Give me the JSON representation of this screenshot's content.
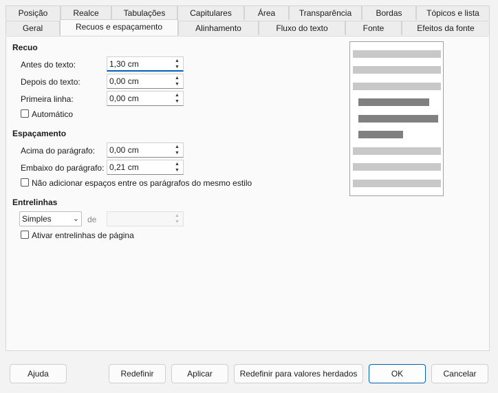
{
  "tabs_row1": [
    "Posição",
    "Realce",
    "Tabulações",
    "Capitulares",
    "Área",
    "Transparência",
    "Bordas",
    "Tópicos e lista"
  ],
  "tabs_row2": [
    "Geral",
    "Recuos e espaçamento",
    "Alinhamento",
    "Fluxo do texto",
    "Fonte",
    "Efeitos da fonte"
  ],
  "active_tab": "Recuos e espaçamento",
  "recuo": {
    "title": "Recuo",
    "antes_label": "Antes do texto:",
    "antes_value": "1,30 cm",
    "depois_label": "Depois do texto:",
    "depois_value": "0,00 cm",
    "primeira_label": "Primeira linha:",
    "primeira_value": "0,00 cm",
    "automatico_label": "Automático",
    "automatico_checked": false
  },
  "espacamento": {
    "title": "Espaçamento",
    "acima_label": "Acima do parágrafo:",
    "acima_value": "0,00 cm",
    "embaixo_label": "Embaixo do parágrafo:",
    "embaixo_value": "0,21 cm",
    "nao_adicionar_label": "Não adicionar espaços entre os parágrafos do mesmo estilo",
    "nao_adicionar_checked": false
  },
  "entrelinhas": {
    "title": "Entrelinhas",
    "selected": "Simples",
    "de_label": "de",
    "de_value": "",
    "ativar_label": "Ativar entrelinhas de página",
    "ativar_checked": false
  },
  "buttons": {
    "ajuda": "Ajuda",
    "redefinir": "Redefinir",
    "aplicar": "Aplicar",
    "herdados": "Redefinir para valores herdados",
    "ok": "OK",
    "cancelar": "Cancelar"
  },
  "colors": {
    "accent": "#005fb8",
    "preview_light": "#c8c8c8",
    "preview_dark": "#808080"
  }
}
